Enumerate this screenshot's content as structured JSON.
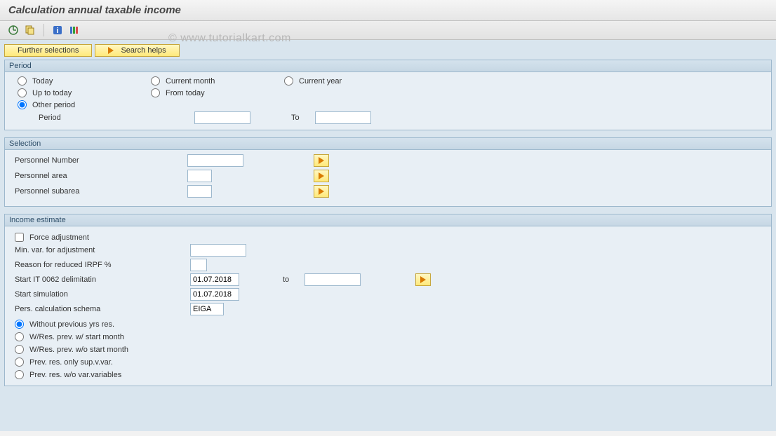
{
  "header": {
    "title": "Calculation annual taxable income"
  },
  "watermark": "© www.tutorialkart.com",
  "toolbar_buttons": {
    "further_selections": "Further selections",
    "search_helps": "Search helps"
  },
  "groups": {
    "period": {
      "title": "Period",
      "radios": {
        "today": "Today",
        "current_month": "Current month",
        "current_year": "Current year",
        "up_to_today": "Up to today",
        "from_today": "From today",
        "other_period": "Other period"
      },
      "period_label": "Period",
      "to_label": "To",
      "from_value": "",
      "to_value": ""
    },
    "selection": {
      "title": "Selection",
      "rows": [
        {
          "label": "Personnel Number",
          "value": ""
        },
        {
          "label": "Personnel area",
          "value": ""
        },
        {
          "label": "Personnel subarea",
          "value": ""
        }
      ]
    },
    "income": {
      "title": "Income estimate",
      "force_adjustment": "Force adjustment",
      "min_var": {
        "label": "Min. var. for adjustment",
        "value": ""
      },
      "reason": {
        "label": "Reason for reduced IRPF %",
        "value": ""
      },
      "start_it": {
        "label": "Start IT 0062 delimitatin",
        "value": "01.07.2018",
        "to_label": "to",
        "to_value": ""
      },
      "start_sim": {
        "label": "Start simulation",
        "value": "01.07.2018"
      },
      "schema": {
        "label": "Pers. calculation schema",
        "value": "EIGA"
      },
      "radios": {
        "r1": "Without  previous yrs res.",
        "r2": "W/Res. prev. w/ start month",
        "r3": "W/Res. prev. w/o start month",
        "r4": "Prev. res. only sup.v.var.",
        "r5": "Prev. res. w/o var.variables"
      }
    }
  }
}
